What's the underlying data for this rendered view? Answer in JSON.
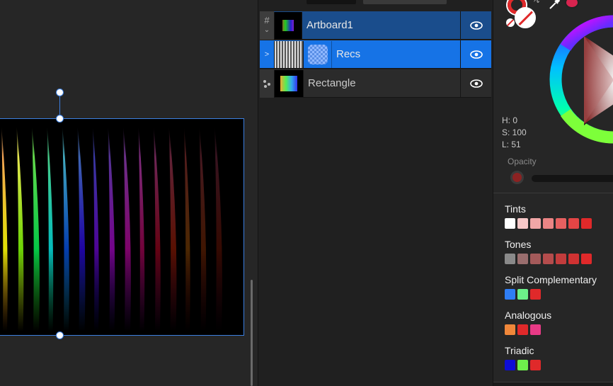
{
  "layers": {
    "items": [
      {
        "name": "Artboard1",
        "state": "selected-dark",
        "thumb": "spectrum-dark"
      },
      {
        "name": "Recs",
        "state": "selected",
        "thumb": "stripes"
      },
      {
        "name": "Rectangle",
        "state": "normal",
        "thumb": "spectrum"
      }
    ],
    "expand_glyph": ">",
    "eye_glyph": "eye-icon"
  },
  "color": {
    "h_label": "H: 0",
    "s_label": "S: 100",
    "l_label": "L: 51",
    "opacity_label": "Opacity",
    "current_color": "#e0292a",
    "sections": [
      {
        "title": "Tints",
        "swatches": [
          "#ffffff",
          "#f7c9c9",
          "#f0a6a6",
          "#ea8484",
          "#e66060",
          "#e34545",
          "#e0292a"
        ]
      },
      {
        "title": "Tones",
        "swatches": [
          "#8a8a8a",
          "#9a6e6e",
          "#a45a5a",
          "#b44c4c",
          "#c23c3c",
          "#d03232",
          "#e0292a"
        ]
      },
      {
        "title": "Split Complementary",
        "swatches": [
          "#2f7ef5",
          "#6cf08a",
          "#e0292a"
        ]
      },
      {
        "title": "Analogous",
        "swatches": [
          "#f0873a",
          "#e0292a",
          "#e83a86"
        ]
      },
      {
        "title": "Triadic",
        "swatches": [
          "#0d0dd6",
          "#6ef04c",
          "#e0292a"
        ]
      }
    ]
  }
}
